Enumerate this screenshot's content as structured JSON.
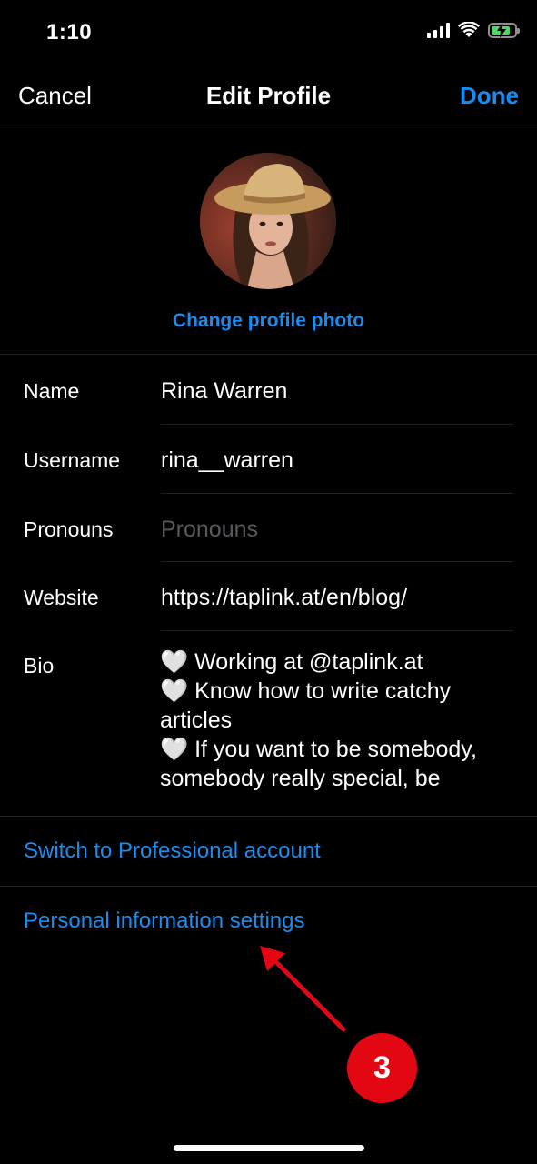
{
  "status_bar": {
    "time": "1:10"
  },
  "nav": {
    "cancel": "Cancel",
    "title": "Edit Profile",
    "done": "Done"
  },
  "profile": {
    "change_photo": "Change profile photo"
  },
  "form": {
    "name": {
      "label": "Name",
      "value": "Rina Warren"
    },
    "username": {
      "label": "Username",
      "value": "rina__warren"
    },
    "pronouns": {
      "label": "Pronouns",
      "placeholder": "Pronouns"
    },
    "website": {
      "label": "Website",
      "value": "https://taplink.at/en/blog/"
    },
    "bio": {
      "label": "Bio",
      "lines": [
        "🤍 Working at @taplink.at",
        "🤍 Know how to write catchy",
        "articles",
        "🤍 If you want to be somebody,",
        "somebody really special, be"
      ]
    }
  },
  "links": {
    "professional": "Switch to Professional account",
    "personal_info": "Personal information settings"
  },
  "annotation": {
    "badge": "3",
    "color": "#e30613"
  },
  "colors": {
    "accent": "#1a8cf0",
    "background": "#000000"
  }
}
